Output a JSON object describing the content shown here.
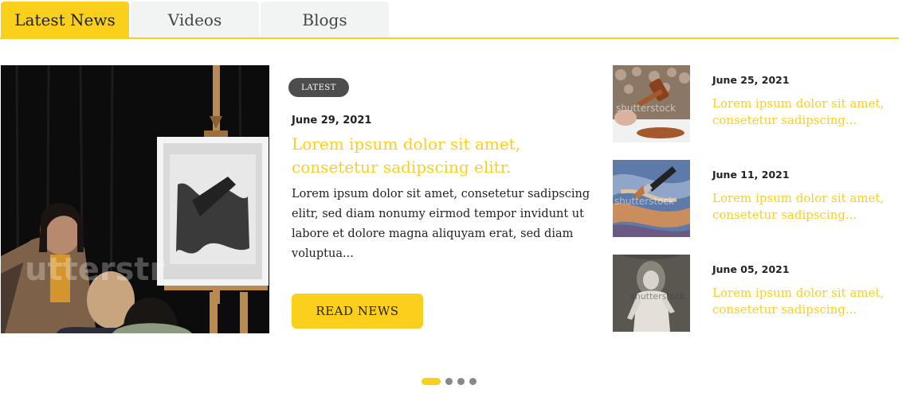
{
  "tabs": [
    {
      "label": "Latest News",
      "active": true
    },
    {
      "label": "Videos",
      "active": false
    },
    {
      "label": "Blogs",
      "active": false
    }
  ],
  "featured": {
    "badge": "LATEST",
    "date": "June 29, 2021",
    "title": "Lorem ipsum dolor sit amet, consetetur sadipscing elitr.",
    "body": "Lorem ipsum dolor sit amet, consetetur sadipscing elitr, sed diam nonumy eirmod tempor invidunt ut labore et dolore magna aliquyam erat, sed diam voluptua...",
    "button": "READ NEWS",
    "watermark": "utterstr"
  },
  "side_news": [
    {
      "date": "June 25, 2021",
      "title": "Lorem ipsum dolor sit amet, consetetur sadipscing...",
      "watermark": "shutterstock",
      "thumb": "auction-gavel"
    },
    {
      "date": "June 11, 2021",
      "title": "Lorem ipsum dolor sit amet, consetetur sadipscing...",
      "watermark": "shutterstock",
      "thumb": "paint-brush"
    },
    {
      "date": "June 05, 2021",
      "title": "Lorem ipsum dolor sit amet, consetetur sadipscing...",
      "watermark": "shutterstock",
      "thumb": "statue"
    }
  ],
  "pager": {
    "count": 4,
    "active": 1
  },
  "colors": {
    "accent": "#fbd01d",
    "badge": "#4d4d4d",
    "text": "#222222",
    "tab_inactive": "#f2f3f3"
  }
}
